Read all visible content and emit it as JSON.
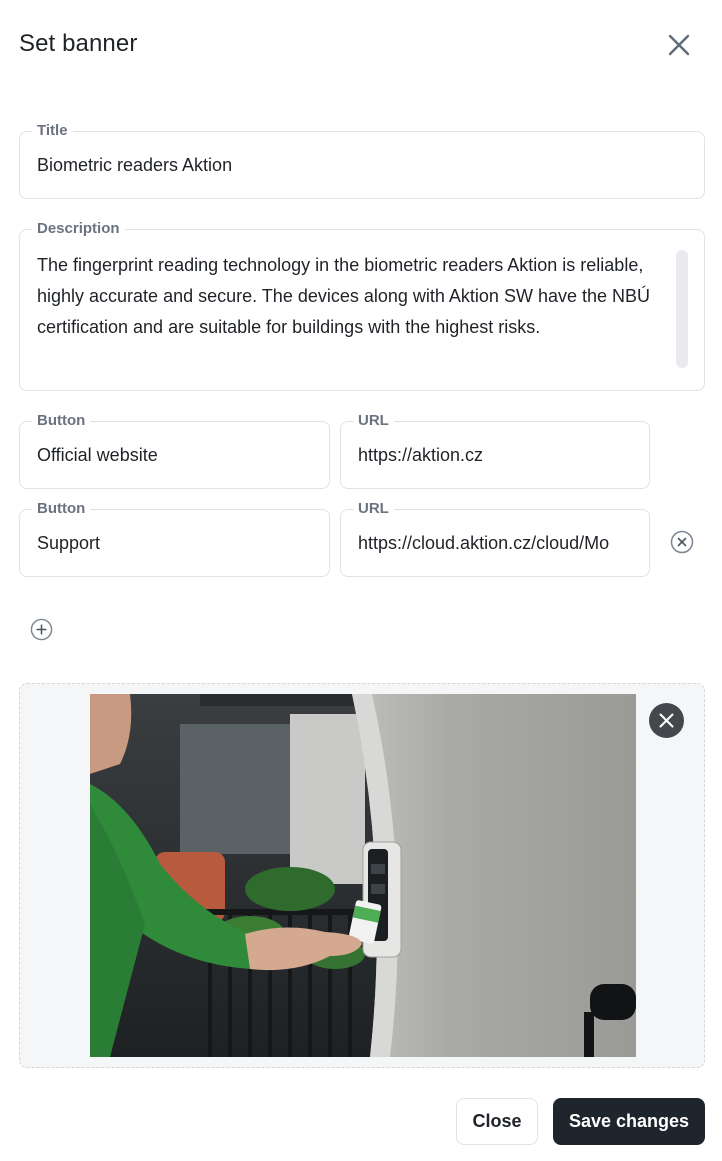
{
  "dialog": {
    "title": "Set banner"
  },
  "form": {
    "title_field": {
      "label": "Title",
      "value": "Biometric readers Aktion"
    },
    "description_field": {
      "label": "Description",
      "value": "The fingerprint reading technology in the biometric readers Aktion is reliable, highly accurate and secure. The devices along with Aktion SW have the NBÚ certification and are suitable for buildings with the highest risks."
    },
    "buttons": [
      {
        "button_label": "Button",
        "button_value": "Official website",
        "url_label": "URL",
        "url_value": "https://aktion.cz"
      },
      {
        "button_label": "Button",
        "button_value": "Support",
        "url_label": "URL",
        "url_value": "https://cloud.aktion.cz/cloud/Mo"
      }
    ]
  },
  "image": {
    "description": "photo"
  },
  "footer": {
    "close_label": "Close",
    "save_label": "Save changes"
  },
  "colors": {
    "primary_button": "#1f252d",
    "border": "#dfe3e8",
    "label": "#6b7280"
  }
}
